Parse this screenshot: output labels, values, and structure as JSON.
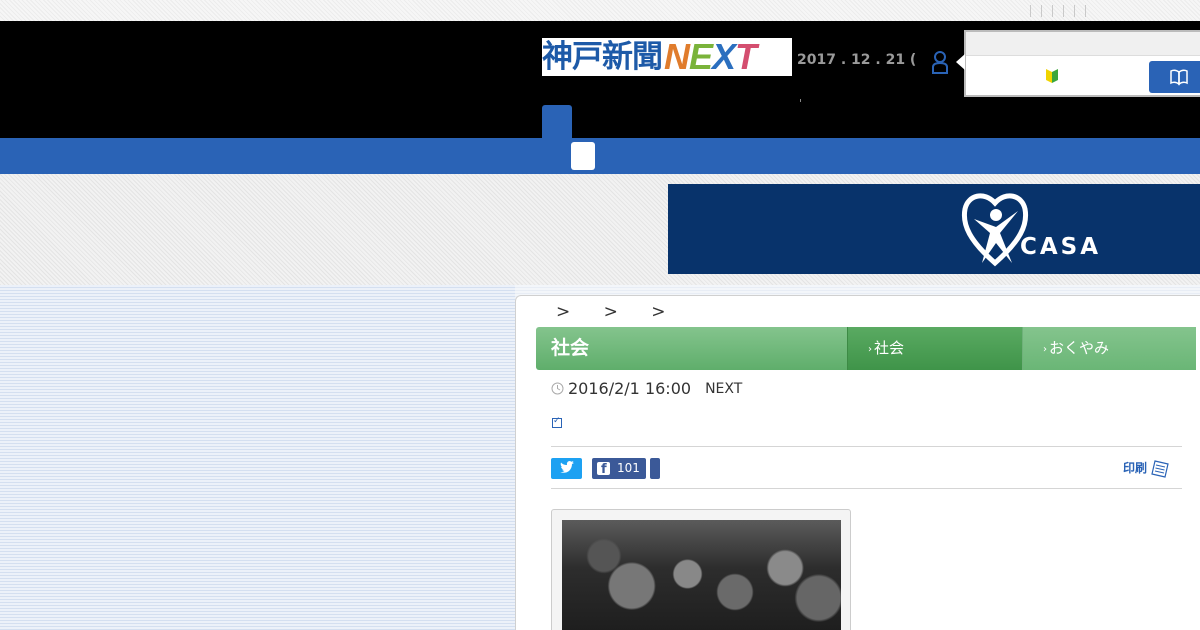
{
  "header": {
    "logo_jp": "神戸新聞",
    "logo_next": [
      "N",
      "E",
      "X",
      "T"
    ],
    "date": "2017 . 12 . 21 (",
    "user_icon": "user-icon",
    "popup_icons": [
      "beginner-mark-icon",
      "book-icon"
    ]
  },
  "banner": {
    "brand": "CASA",
    "background": "#08336b"
  },
  "article": {
    "breadcrumb": "> > >",
    "category_main": "社会",
    "tabs": [
      {
        "label": "社会",
        "active": true
      },
      {
        "label": "おくやみ",
        "active": false
      }
    ],
    "published": "2016/2/1 16:00",
    "source": "NEXT",
    "share": {
      "facebook_count": "101"
    },
    "print_label": "印刷"
  },
  "colors": {
    "nav_blue": "#2a63b6",
    "category_green": "#6ab676",
    "twitter": "#1da1f2",
    "facebook": "#3b5998"
  }
}
